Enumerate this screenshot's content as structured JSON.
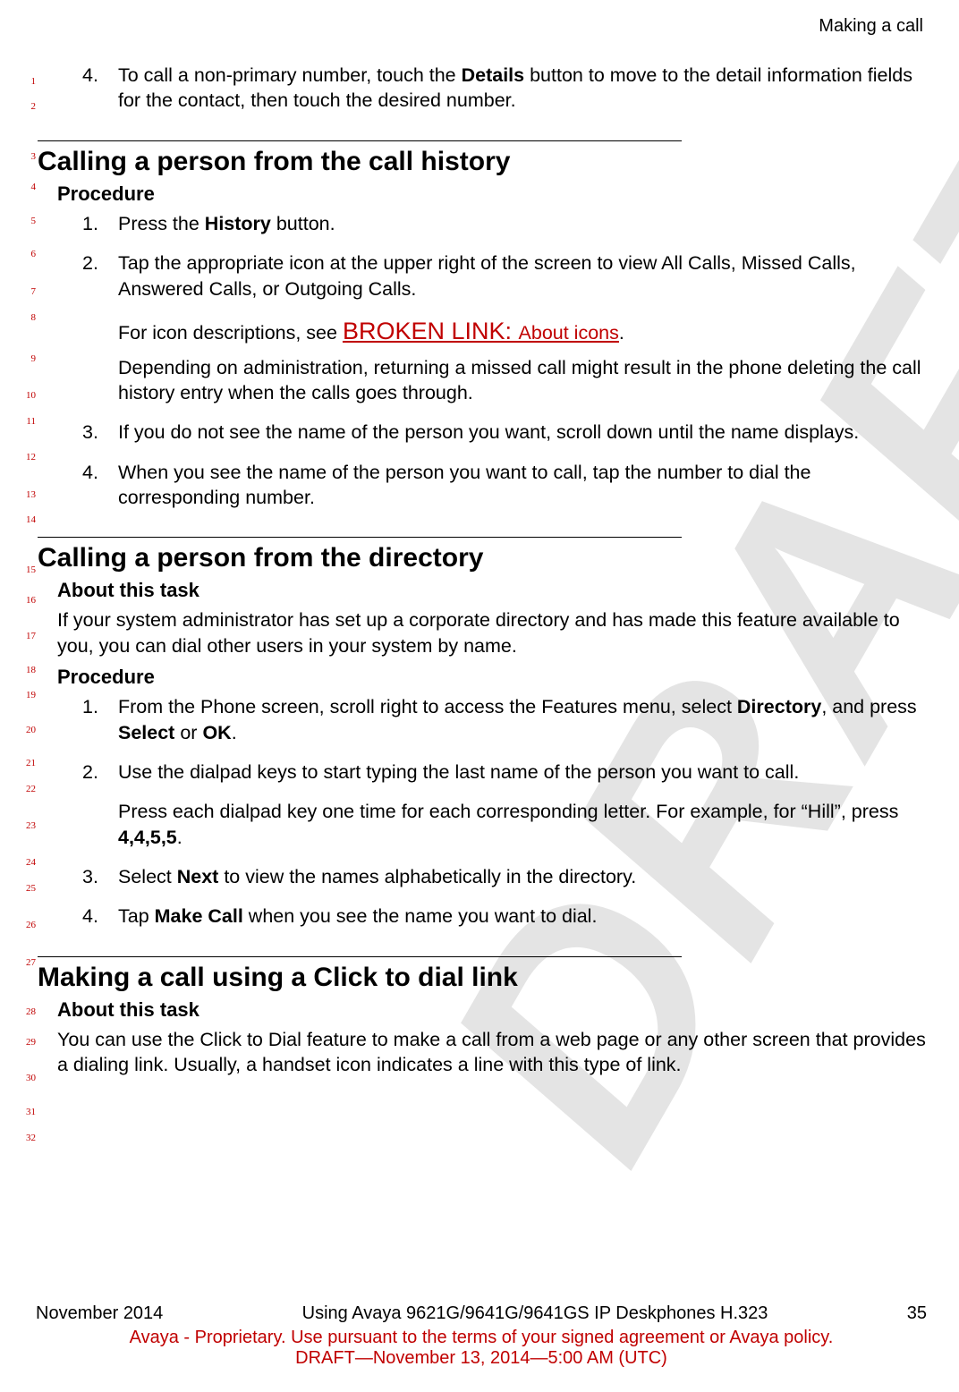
{
  "header": {
    "title": "Making a call"
  },
  "watermark": "DRAFT",
  "line_numbers": {
    "1": 85,
    "2": 113,
    "3": 169,
    "4": 203,
    "5": 241,
    "6": 278,
    "7": 320,
    "8": 349,
    "9": 395,
    "10": 436,
    "11": 465,
    "12": 505,
    "13": 547,
    "14": 575,
    "15": 631,
    "16": 665,
    "17": 705,
    "18": 743,
    "19": 771,
    "20": 810,
    "21": 847,
    "22": 876,
    "23": 917,
    "24": 958,
    "25": 987,
    "26": 1028,
    "27": 1070,
    "28": 1125,
    "29": 1159,
    "30": 1199,
    "31": 1237,
    "32": 1266
  },
  "top_item": {
    "num": "4.",
    "text_a": "To call a non-primary number, touch the ",
    "bold1": "Details",
    "text_b": " button to move to the detail information fields for the contact, then touch the desired number."
  },
  "sec1": {
    "title": "Calling a person from the call history",
    "procedure": "Procedure",
    "items": [
      {
        "num": "1.",
        "pre": "Press the ",
        "bold": "History",
        "post": " button."
      },
      {
        "num": "2.",
        "text": "Tap the appropriate icon at the upper right of the screen to view All Calls, Missed Calls, Answered Calls, or Outgoing Calls."
      }
    ],
    "icon_desc_pre": "For icon descriptions, see ",
    "broken_link_a": "BROKEN LINK: ",
    "broken_link_b": "About icons",
    "icon_desc_post": ".",
    "admin_note": "Depending on administration, returning a missed call might result in the phone deleting the call history entry when the calls goes through.",
    "items2": [
      {
        "num": "3.",
        "text": "If you do not see the name of the person you want, scroll down until the name displays."
      },
      {
        "num": "4.",
        "text": "When you see the name of the person you want to call, tap the number to dial the corresponding number."
      }
    ]
  },
  "sec2": {
    "title": "Calling a person from the directory",
    "about": "About this task",
    "about_text": "If your system administrator has set up a corporate directory and has made this feature available to you, you can dial other users in your system by name.",
    "procedure": "Procedure",
    "item1": {
      "num": "1.",
      "a": "From the Phone screen, scroll right to access the Features menu, select ",
      "b1": "Directory",
      "c": ", and press ",
      "b2": "Select",
      "d": " or ",
      "b3": "OK",
      "e": "."
    },
    "item2": {
      "num": "2.",
      "text": "Use the dialpad keys to start typing the last name of the person you want to call."
    },
    "item2_note_a": "Press each dialpad key one time for each corresponding letter. For example, for “Hill”, press ",
    "item2_note_bold": "4,4,5,5",
    "item2_note_b": ".",
    "item3": {
      "num": "3.",
      "a": "Select ",
      "bold": "Next",
      "b": " to view the names alphabetically in the directory."
    },
    "item4": {
      "num": "4.",
      "a": "Tap ",
      "bold": "Make Call",
      "b": " when you see the name you want to dial."
    }
  },
  "sec3": {
    "title": "Making a call using a Click to dial link",
    "about": "About this task",
    "about_text": "You can use the Click to Dial feature to make a call from a web page or any other screen that provides a dialing link. Usually, a handset icon indicates a line with this type of link."
  },
  "footer": {
    "left": "November 2014",
    "center": "Using Avaya 9621G/9641G/9641GS IP Deskphones H.323",
    "page": "35",
    "line1": "Avaya - Proprietary. Use pursuant to the terms of your signed agreement or Avaya policy.",
    "line2": "DRAFT—November 13, 2014—5:00 AM (UTC)"
  }
}
